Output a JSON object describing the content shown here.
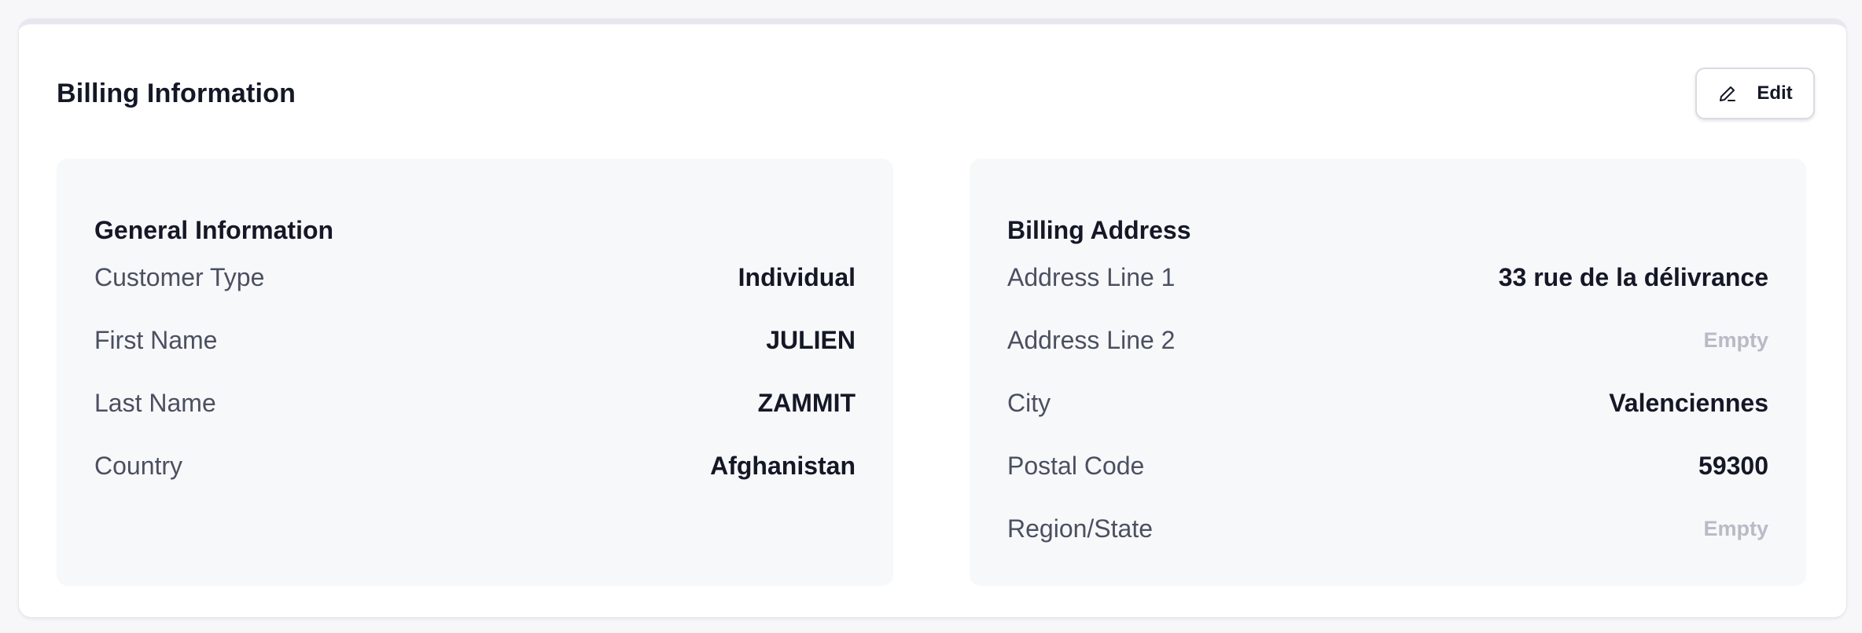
{
  "card": {
    "title": "Billing Information",
    "edit_label": "Edit"
  },
  "general": {
    "title": "General Information",
    "rows": [
      {
        "label": "Customer Type",
        "value": "Individual"
      },
      {
        "label": "First Name",
        "value": "JULIEN"
      },
      {
        "label": "Last Name",
        "value": "ZAMMIT"
      },
      {
        "label": "Country",
        "value": "Afghanistan"
      }
    ]
  },
  "billing_address": {
    "title": "Billing Address",
    "rows": [
      {
        "label": "Address Line 1",
        "value": "33 rue de la délivrance"
      },
      {
        "label": "Address Line 2",
        "value": "Empty"
      },
      {
        "label": "City",
        "value": "Valenciennes"
      },
      {
        "label": "Postal Code",
        "value": "59300"
      },
      {
        "label": "Region/State",
        "value": "Empty"
      }
    ]
  },
  "icons": {
    "edit": "pencil-icon"
  },
  "colors": {
    "text": "#141826",
    "muted": "#4b5060",
    "empty": "#b8bbc6",
    "panel_bg": "#f7f8fa",
    "page_bg": "#f7f7fa"
  }
}
